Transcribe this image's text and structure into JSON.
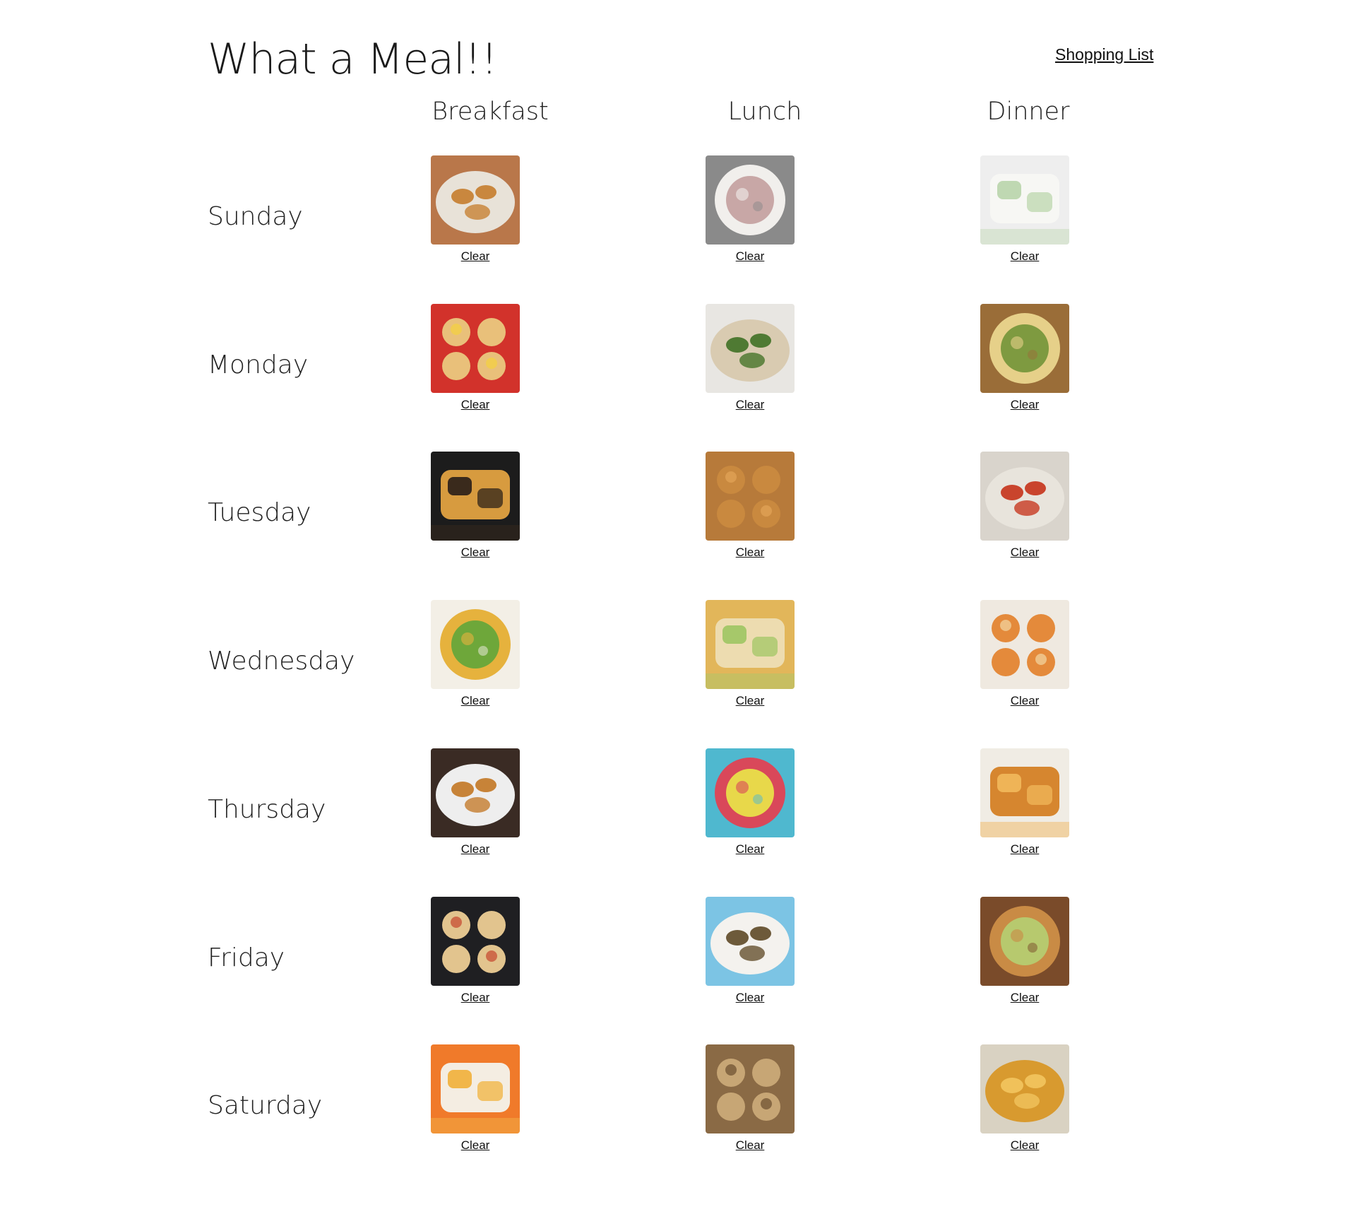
{
  "header": {
    "title": "What a Meal!!",
    "shopping_link": "Shopping List"
  },
  "columns": [
    "Breakfast",
    "Lunch",
    "Dinner"
  ],
  "clear_label": "Clear",
  "days": [
    {
      "name": "Sunday",
      "meals": [
        {
          "icon": "pigs-in-blanket-photo",
          "bg": "#b9774a",
          "plate": "#e8e2d8",
          "accent": "#c9873e"
        },
        {
          "icon": "creamed-toast-photo",
          "bg": "#8a8a8a",
          "plate": "#f1efec",
          "accent": "#c8a7a6"
        },
        {
          "icon": "mint-ice-cream-photo",
          "bg": "#eeeeee",
          "plate": "#f7f7f4",
          "accent": "#bfd8b2"
        }
      ]
    },
    {
      "name": "Monday",
      "meals": [
        {
          "icon": "breakfast-burrito-photo",
          "bg": "#d2322b",
          "plate": "#e9c07a",
          "accent": "#f4d13e"
        },
        {
          "icon": "green-salad-photo",
          "bg": "#e8e6e2",
          "plate": "#d9cbb1",
          "accent": "#4f7a33"
        },
        {
          "icon": "calzone-photo",
          "bg": "#9a6d38",
          "plate": "#e6d089",
          "accent": "#7e9a40"
        }
      ]
    },
    {
      "name": "Tuesday",
      "meals": [
        {
          "icon": "grilled-sandwich-photo",
          "bg": "#1c1c1c",
          "plate": "#d79b3f",
          "accent": "#3a2a1c"
        },
        {
          "icon": "sweet-potato-biscuits-photo",
          "bg": "#b77a3a",
          "plate": "#c9893f",
          "accent": "#e2a458"
        },
        {
          "icon": "panzanella-salad-photo",
          "bg": "#d9d4cc",
          "plate": "#e8e4dc",
          "accent": "#c9442d"
        }
      ]
    },
    {
      "name": "Wednesday",
      "meals": [
        {
          "icon": "egg-casserole-photo",
          "bg": "#f3efe6",
          "plate": "#e6b23d",
          "accent": "#6ea73a"
        },
        {
          "icon": "chips-and-veggies-photo",
          "bg": "#e2b65a",
          "plate": "#eddcb0",
          "accent": "#a6c86a"
        },
        {
          "icon": "seeded-bread-photo",
          "bg": "#efe9e0",
          "plate": "#e48a3b",
          "accent": "#f2d7a4"
        }
      ]
    },
    {
      "name": "Thursday",
      "meals": [
        {
          "icon": "crescent-rolls-photo",
          "bg": "#3a2b24",
          "plate": "#eeeeee",
          "accent": "#c78338"
        },
        {
          "icon": "strawberry-smoothie-photo",
          "bg": "#4fb8cf",
          "plate": "#d9485a",
          "accent": "#e8d84a"
        },
        {
          "icon": "dinner-rolls-photo",
          "bg": "#f0ece4",
          "plate": "#d6862f",
          "accent": "#efb457"
        }
      ]
    },
    {
      "name": "Friday",
      "meals": [
        {
          "icon": "flatbread-pizza-photo",
          "bg": "#1f1f22",
          "plate": "#e2c48e",
          "accent": "#c6462e"
        },
        {
          "icon": "grain-bowl-photo",
          "bg": "#7cc4e4",
          "plate": "#f4f2ee",
          "accent": "#6d5a3a"
        },
        {
          "icon": "burger-sliders-photo",
          "bg": "#7a4b2a",
          "plate": "#c98b45",
          "accent": "#b7c96e"
        }
      ]
    },
    {
      "name": "Saturday",
      "meals": [
        {
          "icon": "parfait-cups-photo",
          "bg": "#f07a2a",
          "plate": "#f4ede2",
          "accent": "#f1b64a"
        },
        {
          "icon": "quick-bread-photo",
          "bg": "#8a6a45",
          "plate": "#c7a675",
          "accent": "#6b4e2e"
        },
        {
          "icon": "yeast-rolls-photo",
          "bg": "#d9d2c2",
          "plate": "#d89a2f",
          "accent": "#f0c15a"
        }
      ]
    }
  ]
}
